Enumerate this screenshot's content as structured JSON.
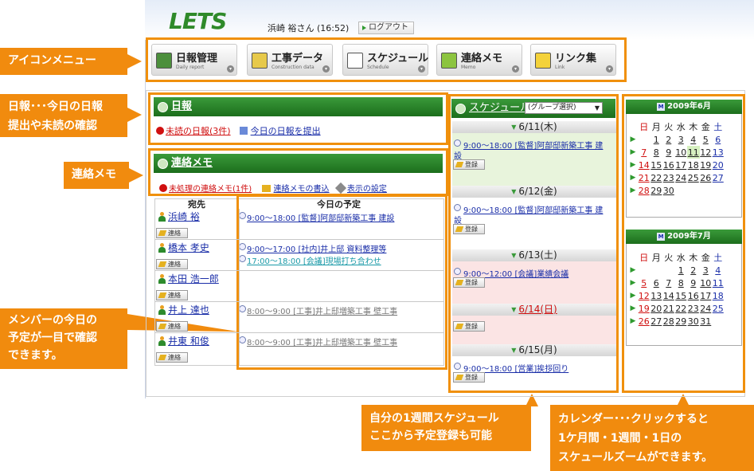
{
  "header": {
    "logo": "LETS",
    "user": "浜崎 裕さん (16:52)",
    "logout": "ログアウト"
  },
  "menu": [
    {
      "label": "日報管理",
      "sub": "Daily report",
      "color": "#4c8f3c"
    },
    {
      "label": "工事データ",
      "sub": "Construction data",
      "color": "#e7c94a"
    },
    {
      "label": "スケジュール",
      "sub": "Schedule",
      "color": "#ffffff"
    },
    {
      "label": "連絡メモ",
      "sub": "Memo",
      "color": "#8cc43f"
    },
    {
      "label": "リンク集",
      "sub": "Link",
      "color": "#f4d23a"
    }
  ],
  "callouts": {
    "icon_menu": "アイコンメニュー",
    "nippo_line1": "日報･･･今日の日報",
    "nippo_line2": "提出や未読の確認",
    "memo": "連絡メモ",
    "member_line1": "メンバーの今日の",
    "member_line2": "予定が一目で確認",
    "member_line3": "できます。",
    "week_line1": "自分の1週間スケジュール",
    "week_line2": "ここから予定登録も可能",
    "cal_line1": "カレンダー･･･クリックすると",
    "cal_line2": "1ケ月間・1週間・1日の",
    "cal_line3": "スケュールズームができます。"
  },
  "nippo": {
    "title": "日報",
    "unread": "未読の日報(3件)",
    "submit": "今日の日報を提出"
  },
  "memo": {
    "title": "連絡メモ",
    "unprocessed": "未処理の連絡メモ(1件)",
    "write": "連絡メモの書込",
    "display": "表示の設定"
  },
  "members": {
    "col_to": "宛先",
    "col_today": "今日の予定",
    "contact_label": "連絡",
    "rows": [
      {
        "name": "浜崎 裕",
        "sched": [
          "9:00～18:00 [監督]阿部邸新築工事 建設"
        ]
      },
      {
        "name": "橋本 孝史",
        "sched": [
          "9:00～17:00 [社内]井上邸 資料整理等",
          "17:00～18:00 [会議]現場打ち合わせ"
        ]
      },
      {
        "name": "本田 浩一郎",
        "sched": []
      },
      {
        "name": "井上 達也",
        "sched": [
          "8:00～9:00 [工事]井上邸増築工事 壁工事"
        ]
      },
      {
        "name": "井東 和俊",
        "sched": [
          "8:00～9:00 [工事]井上邸増築工事 壁工事"
        ]
      }
    ]
  },
  "schedule": {
    "title": "スケジュール",
    "select": "(グループ選択)",
    "register": "登録",
    "days": [
      {
        "date": "6/11(木)",
        "entry": "9:00～18:00 [監督]阿部邸新築工事 建",
        "entry2": "設"
      },
      {
        "date": "6/12(金)",
        "entry": "9:00～18:00 [監督]阿部邸新築工事 建",
        "entry2": "設"
      },
      {
        "date": "6/13(土)",
        "entry": "9:00～12:00 [会議]業績会議",
        "entry2": ""
      },
      {
        "date": "6/14(日)",
        "entry": "",
        "entry2": ""
      },
      {
        "date": "6/15(月)",
        "entry": "9:00～18:00 [営業]挨拶回り",
        "entry2": ""
      }
    ]
  },
  "calendar": {
    "weekdays": [
      "日",
      "月",
      "火",
      "水",
      "木",
      "金",
      "土"
    ],
    "june": {
      "title": "2009年6月",
      "weeks": [
        [
          "",
          "1",
          "2",
          "3",
          "4",
          "5",
          "6"
        ],
        [
          "7",
          "8",
          "9",
          "10",
          "11",
          "12",
          "13"
        ],
        [
          "14",
          "15",
          "16",
          "17",
          "18",
          "19",
          "20"
        ],
        [
          "21",
          "22",
          "23",
          "24",
          "25",
          "26",
          "27"
        ],
        [
          "28",
          "29",
          "30",
          "",
          "",
          "",
          ""
        ]
      ]
    },
    "july": {
      "title": "2009年7月",
      "weeks": [
        [
          "",
          "",
          "",
          "1",
          "2",
          "3",
          "4"
        ],
        [
          "5",
          "6",
          "7",
          "8",
          "9",
          "10",
          "11"
        ],
        [
          "12",
          "13",
          "14",
          "15",
          "16",
          "17",
          "18"
        ],
        [
          "19",
          "20",
          "21",
          "22",
          "23",
          "24",
          "25"
        ],
        [
          "26",
          "27",
          "28",
          "29",
          "30",
          "31",
          ""
        ]
      ]
    }
  }
}
